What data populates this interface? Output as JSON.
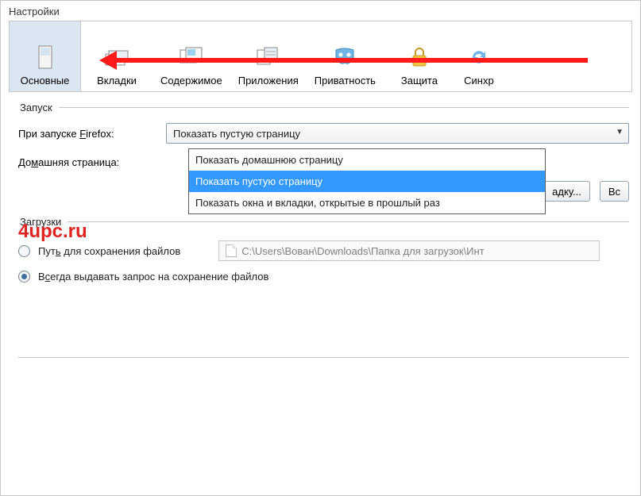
{
  "window": {
    "title": "Настройки"
  },
  "toolbar": {
    "items": [
      {
        "label": "Основные"
      },
      {
        "label": "Вкладки"
      },
      {
        "label": "Содержимое"
      },
      {
        "label": "Приложения"
      },
      {
        "label": "Приватность"
      },
      {
        "label": "Защита"
      },
      {
        "label": "Синхр"
      }
    ]
  },
  "startup": {
    "legend": "Запуск",
    "when_launch_prefix": "При запуске ",
    "when_launch_key": "F",
    "when_launch_suffix": "irefox:",
    "selected": "Показать пустую страницу",
    "options": [
      "Показать домашнюю страницу",
      "Показать пустую страницу",
      "Показать окна и вкладки, открытые в прошлый раз"
    ],
    "homepage_prefix": "До",
    "homepage_key": "м",
    "homepage_suffix": "ашняя страница:",
    "btn_bookmark_suffix": "адку...",
    "btn_restore_prefix": "Вс"
  },
  "downloads": {
    "legend": "Загрузки",
    "save_path_prefix": "Пут",
    "save_path_key": "ь",
    "save_path_suffix": " для сохранения файлов",
    "path_value": "C:\\Users\\Вован\\Downloads\\Папка для загрузок\\Инт",
    "always_ask_prefix": "В",
    "always_ask_key": "с",
    "always_ask_suffix": "егда выдавать запрос на сохранение файлов"
  },
  "watermark": "4upc.ru",
  "colors": {
    "accent": "#3399ff",
    "arrow": "#ff1a1a",
    "watermark": "#e0231f"
  }
}
